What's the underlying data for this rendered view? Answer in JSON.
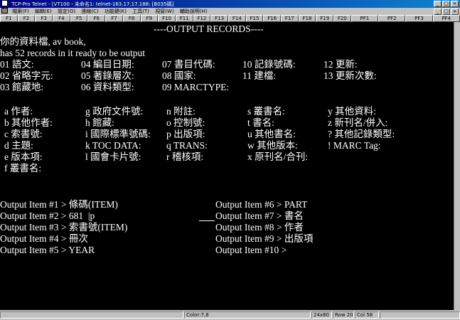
{
  "window": {
    "title": "TCP-Pro Telnet - [VT100 - 未命名1: telnet-163.17.17.188: [B035碼]"
  },
  "menu": [
    "檔案(F)",
    "編輯(E)",
    "設定(O)",
    "連線(C)",
    "功能鍵(K)",
    "工具(T)",
    "視窗(W)",
    "輔助說明(H)"
  ],
  "fkeys": [
    "F1",
    "F2",
    "F3",
    "F4",
    "F5",
    "F6",
    "F7",
    "F8",
    "F9",
    "F10",
    "F11",
    "F12",
    "F13",
    "F14",
    "F15",
    "F16",
    "F17",
    "F18",
    "F19",
    "F20",
    "PF1",
    "PF2",
    "PF3",
    "PF4"
  ],
  "terminal": {
    "heading": "----OUTPUT RECORDS----",
    "intro1": "你的資料檔, av book,",
    "intro2": "has 52 records in it ready to be output",
    "fields": [
      [
        "01 語文:",
        "04 編目日期:",
        "07 書目代碼:",
        "10 記錄號碼:",
        "12 更新:"
      ],
      [
        "02 省略字元:",
        "05 著錄層次:",
        "08 國家:",
        "11 建檔:",
        "13 更新次數:"
      ],
      [
        "03 館藏地:",
        "06 資料類型:",
        "09 MARCTYPE:",
        "",
        ""
      ]
    ],
    "codes": [
      [
        "a 作者:",
        "g 政府文件號:",
        "n 附註:",
        "s 叢書名:",
        "y 其他資料:"
      ],
      [
        "b 其他作者:",
        "h 館藏:",
        "o 控制號:",
        "t 書名:",
        "z 新刊名/併入:"
      ],
      [
        "c 索書號:",
        "i 國際標準號碼:",
        "p 出版項:",
        "u 其他書名:",
        "? 其他記錄類型:"
      ],
      [
        "d 主題:",
        "k TOC DATA:",
        "q TRANS:",
        "w 其他版本:",
        "! MARC Tag:"
      ],
      [
        "e 版本項:",
        "l 國會卡片號:",
        "r 稽核項:",
        "x 原刊名/合刊:",
        ""
      ],
      [
        "f 叢書名:",
        "",
        "",
        "",
        ""
      ]
    ],
    "output_left": [
      "Output Item #1 > 條碼(ITEM)",
      "Output Item #2 > 681  |p",
      "Output Item #3 > 索書號(ITEM)",
      "Output Item #4 > 冊次",
      "Output Item #5 > YEAR"
    ],
    "output_right": [
      "Output Item #6 > PART",
      "Output Item #7 > 書名",
      "Output Item #8 > 作者",
      "Output Item #9 > 出版項",
      "Output Item #10 >"
    ]
  },
  "status": {
    "color": "Color:7,8",
    "size": "24x80",
    "row": "Row 20",
    "col": "Col  58"
  }
}
